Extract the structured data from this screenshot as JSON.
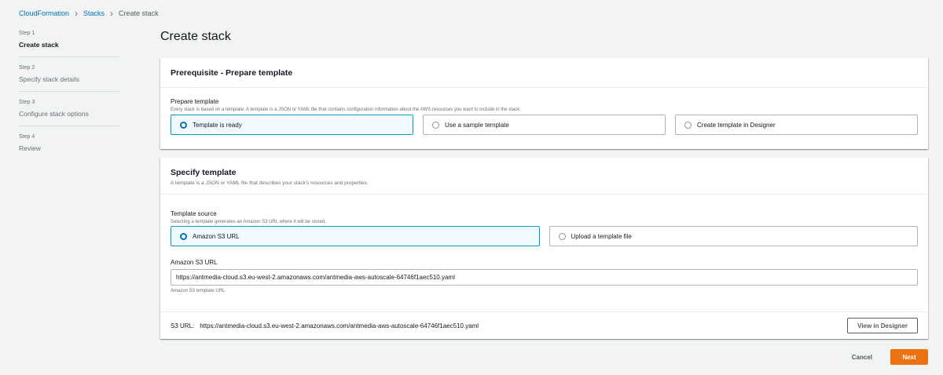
{
  "breadcrumb": {
    "items": [
      "CloudFormation",
      "Stacks",
      "Create stack"
    ]
  },
  "steps": [
    {
      "num": "Step 1",
      "label": "Create stack",
      "active": true
    },
    {
      "num": "Step 2",
      "label": "Specify stack details"
    },
    {
      "num": "Step 3",
      "label": "Configure stack options"
    },
    {
      "num": "Step 4",
      "label": "Review"
    }
  ],
  "page_title": "Create stack",
  "prerequisite": {
    "title": "Prerequisite - Prepare template",
    "field_label": "Prepare template",
    "field_desc": "Every stack is based on a template. A template is a JSON or YAML file that contains configuration information about the AWS resources you want to include in the stack.",
    "options": [
      "Template is ready",
      "Use a sample template",
      "Create template in Designer"
    ],
    "selected": "Template is ready"
  },
  "specify": {
    "title": "Specify template",
    "desc": "A template is a JSON or YAML file that describes your stack's resources and properties.",
    "source_label": "Template source",
    "source_desc": "Selecting a template generates an Amazon S3 URL where it will be stored.",
    "source_options": [
      "Amazon S3 URL",
      "Upload a template file"
    ],
    "selected": "Amazon S3 URL",
    "url_label": "Amazon S3 URL",
    "url_value": "https://antmedia-cloud.s3.eu-west-2.amazonaws.com/antmedia-aws-autoscale-64746f1aec510.yaml",
    "url_hint": "Amazon S3 template URL",
    "s3_label": "S3 URL:",
    "s3_value": "https://antmedia-cloud.s3.eu-west-2.amazonaws.com/antmedia-aws-autoscale-64746f1aec510.yaml",
    "view_button": "View in Designer"
  },
  "actions": {
    "cancel": "Cancel",
    "next": "Next"
  },
  "colors": {
    "link": "#0073bb",
    "primary": "#ec7211",
    "selected_bg": "#f1faff",
    "selected_border": "#00a1c9"
  }
}
